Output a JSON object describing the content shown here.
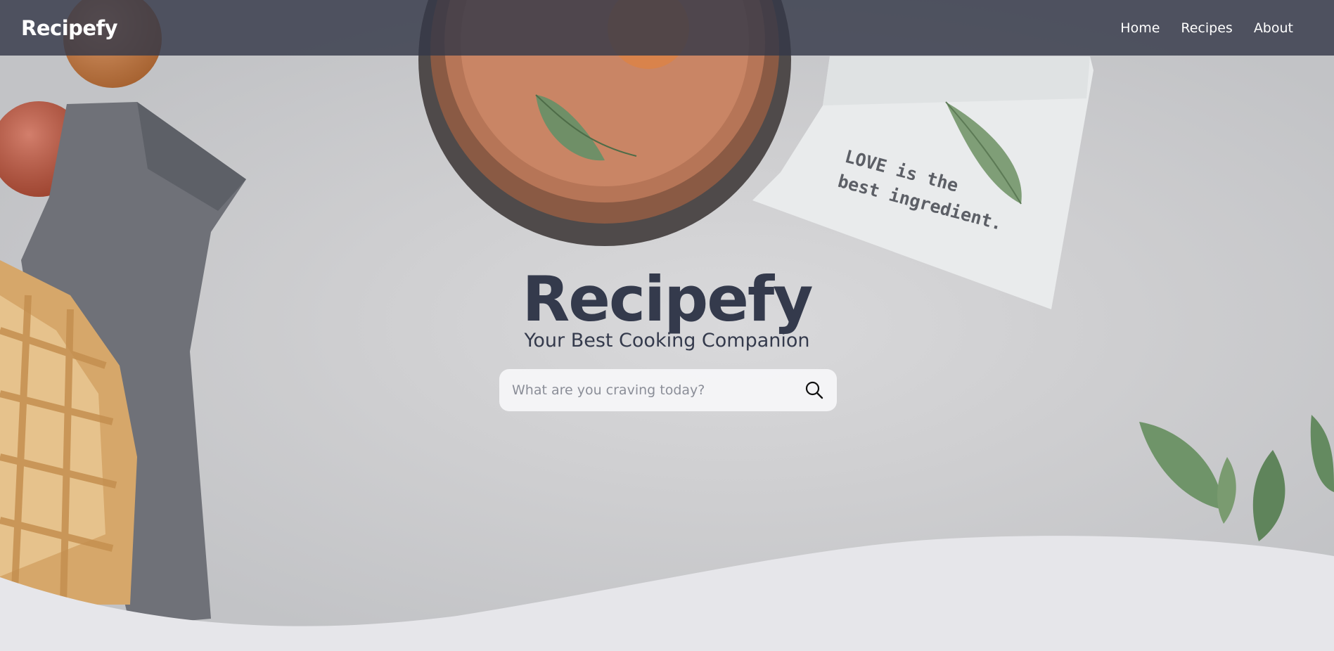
{
  "navbar": {
    "brand": "Recipefy",
    "links": [
      {
        "label": "Home"
      },
      {
        "label": "Recipes"
      },
      {
        "label": "About"
      }
    ]
  },
  "hero": {
    "title": "Recipefy",
    "subtitle": "Your Best Cooking Companion",
    "towel_line_1": "LOVE is the",
    "towel_line_2": "best ingredient."
  },
  "search": {
    "placeholder": "What are you craving today?",
    "icon": "search-icon"
  },
  "colors": {
    "navbar_bg": "#343848",
    "title_text": "#343a4c",
    "page_bottom": "#e6e6ea"
  }
}
